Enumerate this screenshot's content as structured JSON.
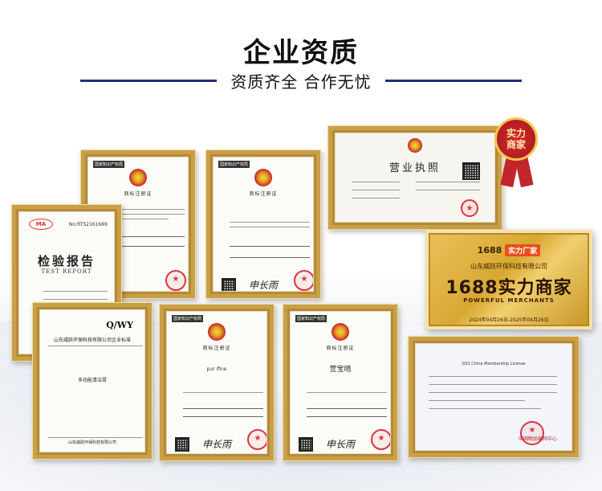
{
  "header": {
    "title": "企业资质",
    "subtitle": "资质齐全  合作无忧"
  },
  "trademark": {
    "header_label": "国家知识产权局",
    "cert_title": "商标注册证",
    "signature": "申长雨",
    "marks": [
      "",
      "pur ifine",
      "萱宝晴"
    ]
  },
  "test_report": {
    "logo": "MA",
    "number": "No:RTS2161669",
    "title": "检验报告",
    "title_en": "TEST REPORT"
  },
  "standard": {
    "code": "Q/WY",
    "org_line": "山东威跃环保科技有限公司企业标准",
    "product": "多功能清洁膏",
    "company": "山东威跃环保科技有限公司"
  },
  "business_license": {
    "title": "营业执照"
  },
  "plaque": {
    "brand": "1688",
    "badge": "实力厂家",
    "company": "山东威跃环保科技有限公司",
    "main": "1688实力商家",
    "english": "POWERFUL MERCHANTS",
    "dates": "2024年04月26日-2025年04月26日"
  },
  "gs1": {
    "title": "GS1 China Membership License",
    "org": "中国物品编码中心"
  },
  "ribbon_badge": {
    "line1": "实力",
    "line2": "商家"
  }
}
